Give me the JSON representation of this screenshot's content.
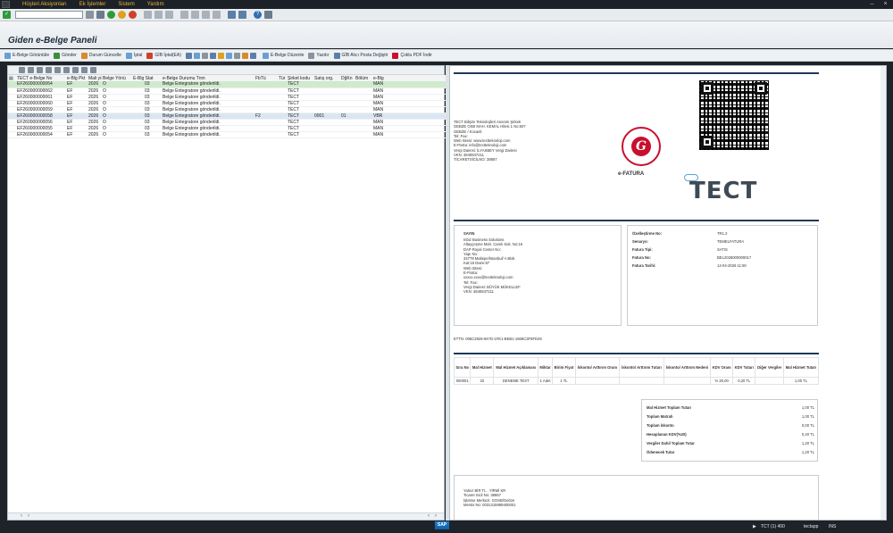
{
  "menu": {
    "items": [
      "Hüşteri Aksiyonları",
      "Ek İşlemler",
      "Sistem",
      "Yardım"
    ]
  },
  "toolbar": {
    "command_value": ""
  },
  "page": {
    "title": "Giden e-Belge Paneli"
  },
  "app_toolbar": [
    "E-Belge Görüntüle",
    "Gönder",
    "Durum Güncelle",
    "İptal",
    "GİB İptal(EA)",
    "E-Belge Düzenle",
    "Yazdır",
    "GİB Alıcı Posta Değiştir",
    "Çoklu PDF İndir"
  ],
  "grid": {
    "columns": [
      "TECT e-Belge No",
      "e-Blg Pkt",
      "Mali yıl",
      "Belge Yönü",
      "E-Blg Stat",
      "e-Belge Durumu Tnm",
      "FbTü",
      "Tür",
      "Şirket kodu",
      "Satış org.",
      "DğKn",
      "Bölüm",
      "e-Blg"
    ],
    "rows": [
      {
        "no": "EF260000000064",
        "pkt": "EF",
        "yil": "2026",
        "yon": "O",
        "stat": "03",
        "durum": "Belge Entegratore gönderildi.",
        "fbtu": "",
        "tur": "",
        "sirket": "TECT",
        "satis": "",
        "dgkn": "",
        "bolum": "",
        "eblg": "MAN",
        "state": "sel"
      },
      {
        "no": "EF260000000062",
        "pkt": "EF",
        "yil": "2026",
        "yon": "O",
        "stat": "03",
        "durum": "Belge Entegratore gönderildi.",
        "fbtu": "",
        "tur": "",
        "sirket": "TECT",
        "satis": "",
        "dgkn": "",
        "bolum": "",
        "eblg": "MAN",
        "state": ""
      },
      {
        "no": "EF260000000061",
        "pkt": "EF",
        "yil": "2026",
        "yon": "O",
        "stat": "03",
        "durum": "Belge Entegratore gönderildi.",
        "fbtu": "",
        "tur": "",
        "sirket": "TECT",
        "satis": "",
        "dgkn": "",
        "bolum": "",
        "eblg": "MAN",
        "state": ""
      },
      {
        "no": "EF260000000060",
        "pkt": "EF",
        "yil": "2026",
        "yon": "O",
        "stat": "03",
        "durum": "Belge Entegratore gönderildi.",
        "fbtu": "",
        "tur": "",
        "sirket": "TECT",
        "satis": "",
        "dgkn": "",
        "bolum": "",
        "eblg": "MAN",
        "state": ""
      },
      {
        "no": "EF260000000059",
        "pkt": "EF",
        "yil": "2026",
        "yon": "O",
        "stat": "03",
        "durum": "Belge Entegratore gönderildi.",
        "fbtu": "",
        "tur": "",
        "sirket": "TECT",
        "satis": "",
        "dgkn": "",
        "bolum": "",
        "eblg": "MAN",
        "state": ""
      },
      {
        "no": "EF260000000058",
        "pkt": "EF",
        "yil": "2026",
        "yon": "O",
        "stat": "03",
        "durum": "Belge Entegratore gönderildi.",
        "fbtu": "F2",
        "tur": "",
        "sirket": "TECT",
        "satis": "0001",
        "dgkn": "01",
        "bolum": "",
        "eblg": "VBR",
        "state": "sel2"
      },
      {
        "no": "EF260000000056",
        "pkt": "EF",
        "yil": "2026",
        "yon": "O",
        "stat": "03",
        "durum": "Belge Entegratore gönderildi.",
        "fbtu": "",
        "tur": "",
        "sirket": "TECT",
        "satis": "",
        "dgkn": "",
        "bolum": "",
        "eblg": "MAN",
        "state": ""
      },
      {
        "no": "EF260000000055",
        "pkt": "EF",
        "yil": "2026",
        "yon": "O",
        "stat": "03",
        "durum": "Belge Entegratore gönderildi.",
        "fbtu": "",
        "tur": "",
        "sirket": "TECT",
        "satis": "",
        "dgkn": "",
        "bolum": "",
        "eblg": "MAN",
        "state": ""
      },
      {
        "no": "EF260000000054",
        "pkt": "EF",
        "yil": "2026",
        "yon": "O",
        "stat": "03",
        "durum": "Belge Entegratore gönderildi.",
        "fbtu": "",
        "tur": "",
        "sirket": "TECT",
        "satis": "",
        "dgkn": "",
        "bolum": "",
        "eblg": "MAN",
        "state": ""
      }
    ]
  },
  "invoice": {
    "sender_lines": [
      "TECT Bilişim Teknolojileri Anonim Şirketi",
      "GEBZE OSB MAH. KEMAL Hilesi 1 No:507",
      "GEBZE / Kocaeli",
      "Tel: Fax:",
      "Web Sitesi: www.tectteknoloji.com",
      "E-Posta: info@tectteknoloji.com",
      "Vergi Dairesi: İLYASBEY Vergi Dairesi",
      "VKN: 4840847211",
      "TİCARETSİCİLNO: 38867"
    ],
    "efatura_label": "e-FATURA",
    "logo_text": "TECT",
    "receiver_title": "SAYIN",
    "receiver_lines": [
      "Inbiz Business Solutions",
      "Altayçeşme Mah. Camlı Sok. No:16",
      "DAP Royal Center  No:",
      "Yapı No:",
      "34779 Maltepe/İstanbul/ A Blok",
      "Kat:15 Daire:67",
      "Web Sitesi:",
      "E-Posta:",
      "xxxxx.xxxx@tectteknoloji.com",
      "Tel: Fax:",
      "Vergi Dairesi: BÜYÜK MÜKELLEF",
      "VKN: 4840847211"
    ],
    "meta": [
      {
        "label": "Özelleştirme No:",
        "value": "TR1.2"
      },
      {
        "label": "Senaryo:",
        "value": "TEMELFATURA"
      },
      {
        "label": "Fatura Tipi:",
        "value": "SATIS"
      },
      {
        "label": "Fatura No:",
        "value": "BEL2026000000017"
      },
      {
        "label": "Fatura Tarihi:",
        "value": "14-04-2026 11:50"
      }
    ],
    "ettn": "ETTN: 006C2926-947D-1FE1-BEB1-1666C3F8FD49",
    "item_headers": [
      "Sıra No",
      "Mal Hizmet",
      "Mal Hizmet Açıklaması",
      "Miktar",
      "Birim Fiyat",
      "İskonto/ Arttırım Oranı",
      "İskonto/ Arttırım Tutarı",
      "İskonto/ Arttırım Nedeni",
      "KDV Oranı",
      "KDV Tutarı",
      "Diğer Vergiler",
      "Mal Hizmet Tutarı"
    ],
    "item_row": [
      "000001",
      "32",
      "DENEME TEST",
      "1 Adet",
      "1 TL",
      "",
      "",
      "",
      "% 20,00",
      "0,20 TL",
      "",
      "1,00 TL"
    ],
    "totals": [
      {
        "label": "Mal Hizmet Toplam Tutarı",
        "value": "1,00 TL"
      },
      {
        "label": "Toplam Matrah",
        "value": "1,00 TL"
      },
      {
        "label": "Toplam İskonto",
        "value": "0,00 TL"
      },
      {
        "label": "Hesaplanan KDV(%20)",
        "value": "0,20 TL"
      },
      {
        "label": "Vergiler Dahil Toplam Tutar",
        "value": "1,20 TL"
      },
      {
        "label": "Ödenecek Tutar",
        "value": "1,20 TL"
      }
    ],
    "footer_lines": [
      "Yalnız BİR TL , YİRMİ KR",
      "Ticaret Sicil No: 38867",
      "İşletme Merkezi: GOSB/Gebze",
      "Mersis No: 0031315999400001"
    ]
  },
  "status": {
    "system": "TCT (1) 400",
    "server": "tectapp",
    "mode": "INS"
  },
  "colors": {
    "accent": "#1e3a5a",
    "selected_row": "#cfeacc",
    "brand_red": "#c8102e"
  }
}
